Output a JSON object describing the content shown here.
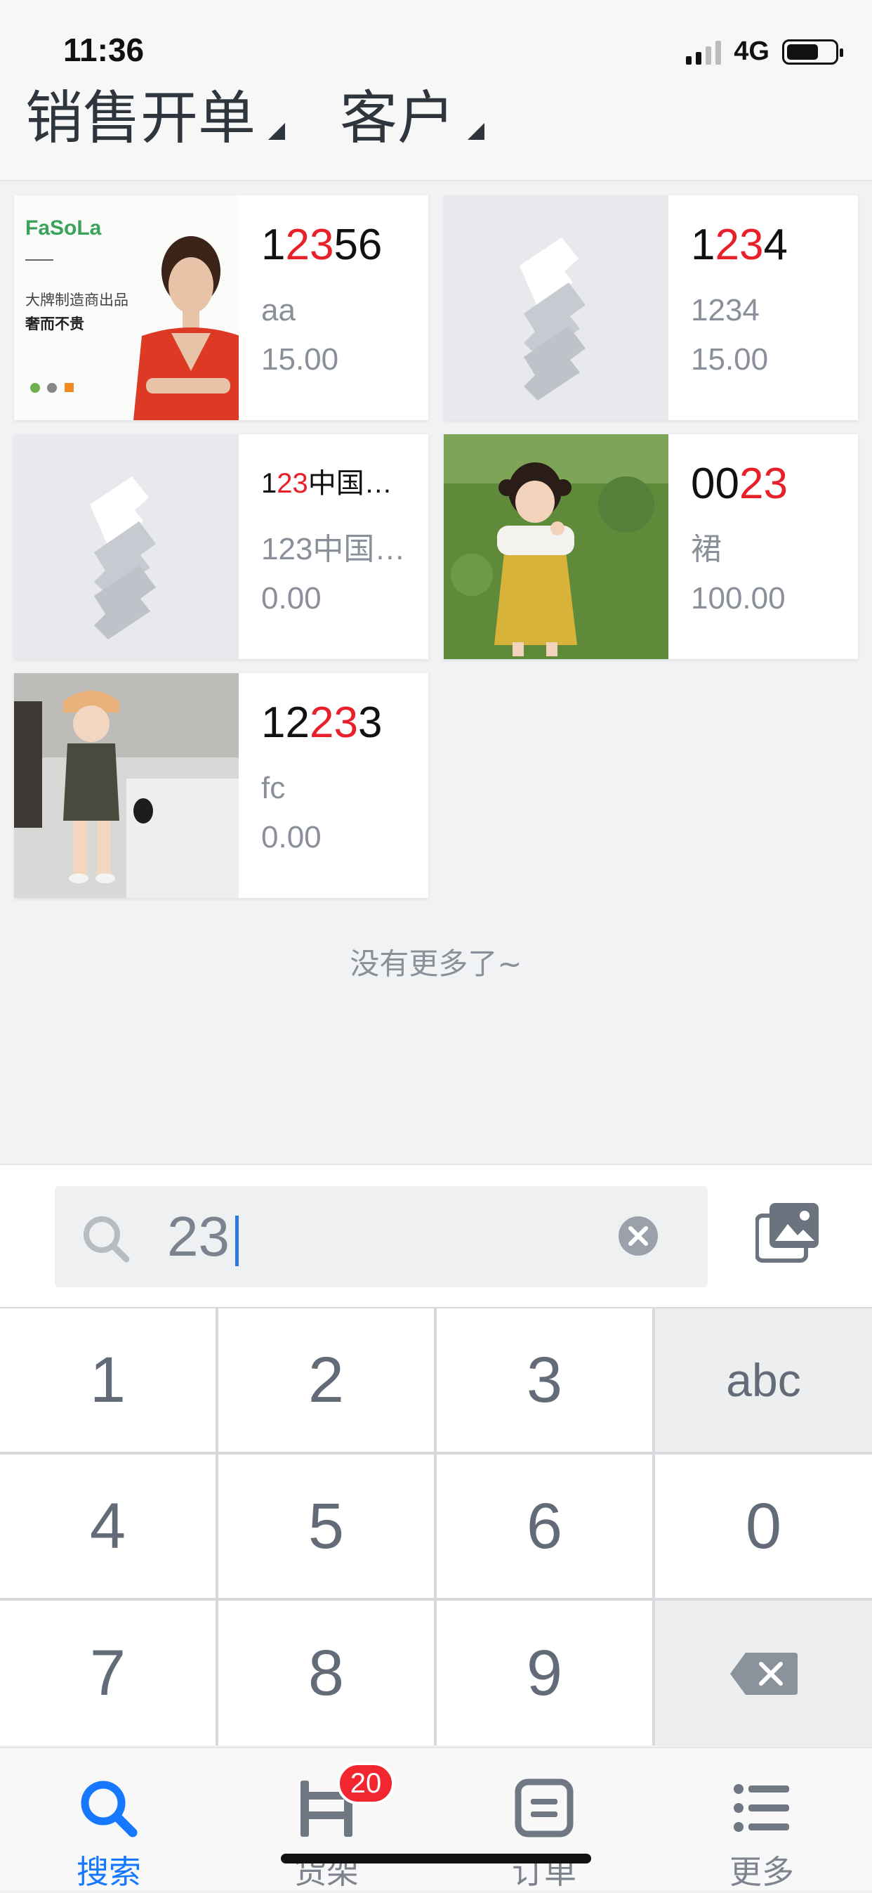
{
  "status_bar": {
    "time": "11:36",
    "network": "4G"
  },
  "header": {
    "title": "销售开单",
    "customer": "客户"
  },
  "products": [
    {
      "code_pre": "1",
      "code_hl": "23",
      "code_post": "56",
      "name": "aa",
      "price": "15.00",
      "image": "fasola-ad-photo",
      "ad_brand": "FaSoLa",
      "ad_line1": "大牌制造商出品",
      "ad_line2": "奢而不贵"
    },
    {
      "code_pre": "1",
      "code_hl": "23",
      "code_post": "4",
      "name": "1234",
      "price": "15.00",
      "image": "placeholder-icon"
    },
    {
      "code_pre": "1",
      "code_hl": "23",
      "code_post": "中国人…",
      "name": "123中国…",
      "price": "0.00",
      "image": "placeholder-icon"
    },
    {
      "code_pre": "00",
      "code_hl": "23",
      "code_post": "",
      "name": "裙",
      "price": "100.00",
      "image": "girl-yellow-dress-photo"
    },
    {
      "code_pre": "12",
      "code_hl": "23",
      "code_post": "3",
      "name": "fc",
      "price": "0.00",
      "image": "girl-bucket-hat-photo"
    }
  ],
  "list_end_text": "没有更多了~",
  "search": {
    "value": "23"
  },
  "keypad": {
    "keys": [
      "1",
      "2",
      "3",
      "abc",
      "4",
      "5",
      "6",
      "0",
      "7",
      "8",
      "9"
    ],
    "backspace": "backspace-icon"
  },
  "tabbar": {
    "tabs": [
      {
        "label": "搜索",
        "icon": "search-icon",
        "active": true
      },
      {
        "label": "货架",
        "icon": "shelf-icon",
        "badge": "20"
      },
      {
        "label": "订单",
        "icon": "order-icon"
      },
      {
        "label": "更多",
        "icon": "more-icon"
      }
    ]
  },
  "colors": {
    "accent": "#1677ff",
    "highlight": "#e8202a",
    "badge": "#f2262f"
  }
}
